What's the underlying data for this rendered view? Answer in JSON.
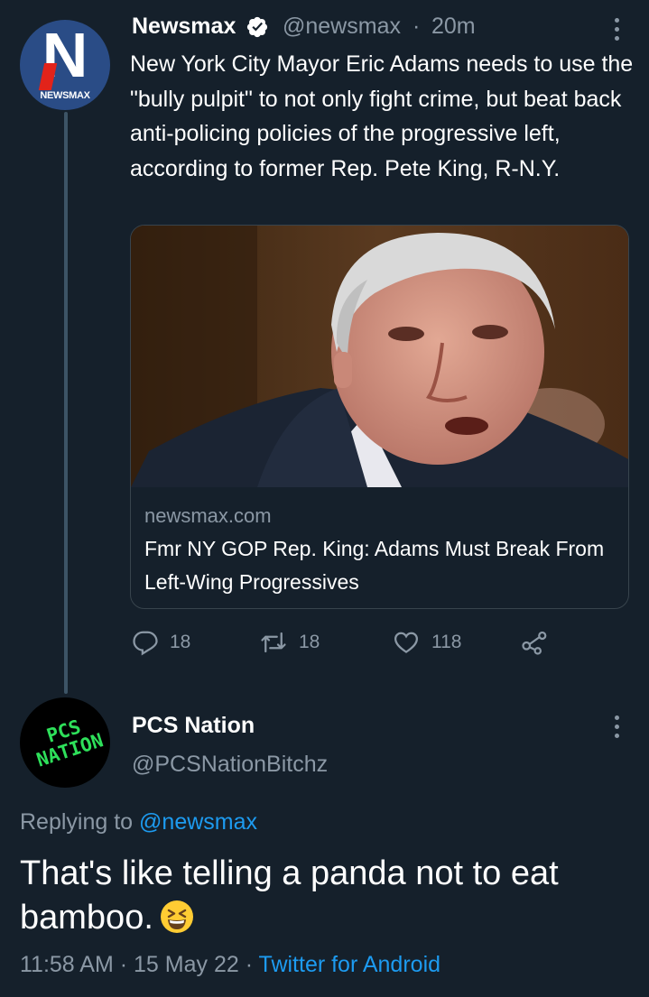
{
  "tweet": {
    "author_name": "Newsmax",
    "author_handle": "@newsmax",
    "separator": "·",
    "time_ago": "20m",
    "avatar_text": "NEWSMAX",
    "avatar_letter": "N",
    "text": "New York City Mayor Eric Adams needs to use the \"bully pulpit\" to not only fight crime, but beat back anti-policing policies of the progressive left, according to former Rep. Pete King, R-N.Y.",
    "card": {
      "domain": "newsmax.com",
      "title": "Fmr NY GOP Rep. King: Adams Must Break From Left-Wing Progressives"
    },
    "actions": {
      "replies": "18",
      "retweets": "18",
      "likes": "118"
    }
  },
  "reply": {
    "author_name": "PCS Nation",
    "author_handle": "@PCSNationBitchz",
    "avatar_text_line1": "PCS",
    "avatar_text_line2": "NATION",
    "replying_prefix": "Replying to",
    "replying_to": "@newsmax",
    "text": "That's like telling a panda not to eat bamboo.",
    "time": "11:58 AM",
    "date": "15 May 22",
    "separator": "·",
    "source": "Twitter for Android"
  },
  "colors": {
    "background": "#15202b",
    "secondary_text": "#8b98a5",
    "accent": "#1d9bf0",
    "border": "#38444d"
  },
  "icons": [
    "verified-badge-icon",
    "more-options-icon",
    "reply-icon",
    "retweet-icon",
    "like-icon",
    "share-icon",
    "grinning-squinting-emoji"
  ]
}
